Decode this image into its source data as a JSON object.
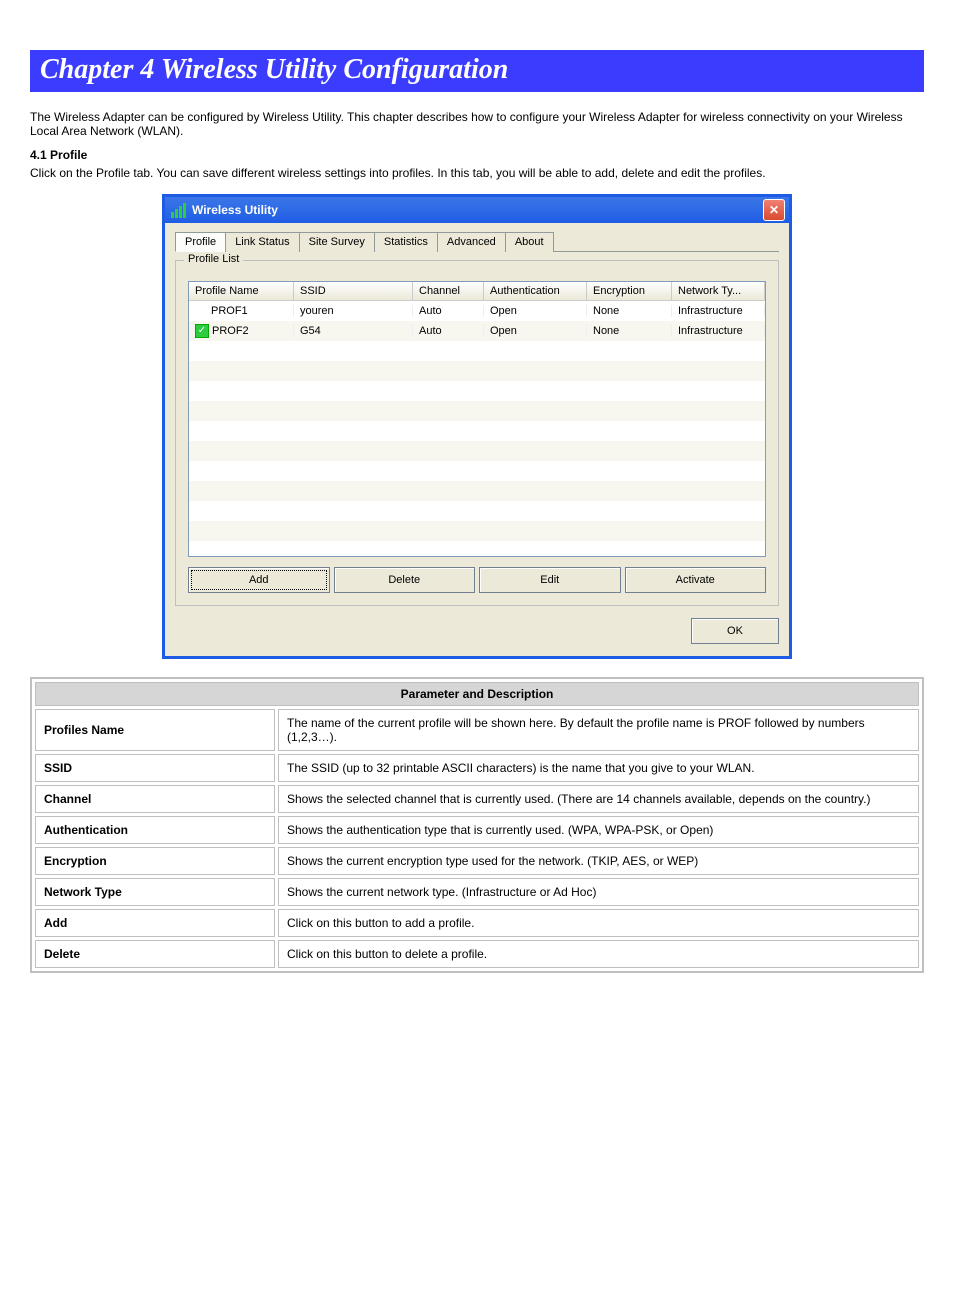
{
  "chapter": {
    "heading": "Chapter 4 Wireless Utility Configuration"
  },
  "intro": "The Wireless Adapter can be configured by Wireless Utility. This chapter describes how to configure your Wireless Adapter for wireless connectivity on your Wireless Local Area Network (WLAN).",
  "profile_section": {
    "title": "4.1 Profile",
    "text": "Click on the Profile tab. You can save different wireless settings into profiles. In this tab, you will be able to add, delete and edit the profiles."
  },
  "window": {
    "title": "Wireless Utility",
    "tabs": [
      "Profile",
      "Link Status",
      "Site Survey",
      "Statistics",
      "Advanced",
      "About"
    ],
    "groupbox_title": "Profile List",
    "columns": {
      "profile_name": "Profile Name",
      "ssid": "SSID",
      "channel": "Channel",
      "authentication": "Authentication",
      "encryption": "Encryption",
      "network_type": "Network Ty..."
    },
    "rows": [
      {
        "active": false,
        "profile_name": "PROF1",
        "ssid": "youren",
        "channel": "Auto",
        "authentication": "Open",
        "encryption": "None",
        "network_type": "Infrastructure"
      },
      {
        "active": true,
        "profile_name": "PROF2",
        "ssid": "G54",
        "channel": "Auto",
        "authentication": "Open",
        "encryption": "None",
        "network_type": "Infrastructure"
      }
    ],
    "buttons": {
      "add": "Add",
      "delete": "Delete",
      "edit": "Edit",
      "activate": "Activate",
      "ok": "OK"
    }
  },
  "desc_table": {
    "header": "Parameter and Description",
    "rows": [
      {
        "param": "Profiles Name",
        "desc": "The name of the current profile will be shown here. By default the profile name is PROF followed by numbers (1,2,3…)."
      },
      {
        "param": "SSID",
        "desc": "The SSID (up to 32 printable ASCII characters) is the name that you give to your WLAN."
      },
      {
        "param": "Channel",
        "desc": "Shows the selected channel that is currently used. (There are 14 channels available, depends on the country.)"
      },
      {
        "param": "Authentication",
        "desc": "Shows the authentication type that is currently used. (WPA, WPA-PSK, or Open)"
      },
      {
        "param": "Encryption",
        "desc": "Shows the current encryption type used for the network. (TKIP, AES, or WEP)"
      },
      {
        "param": "Network Type",
        "desc": "Shows the current network type. (Infrastructure or Ad Hoc)"
      },
      {
        "param": "Add",
        "desc": "Click on this button to add a profile."
      },
      {
        "param": "Delete",
        "desc": "Click on this button to delete a profile."
      }
    ]
  }
}
